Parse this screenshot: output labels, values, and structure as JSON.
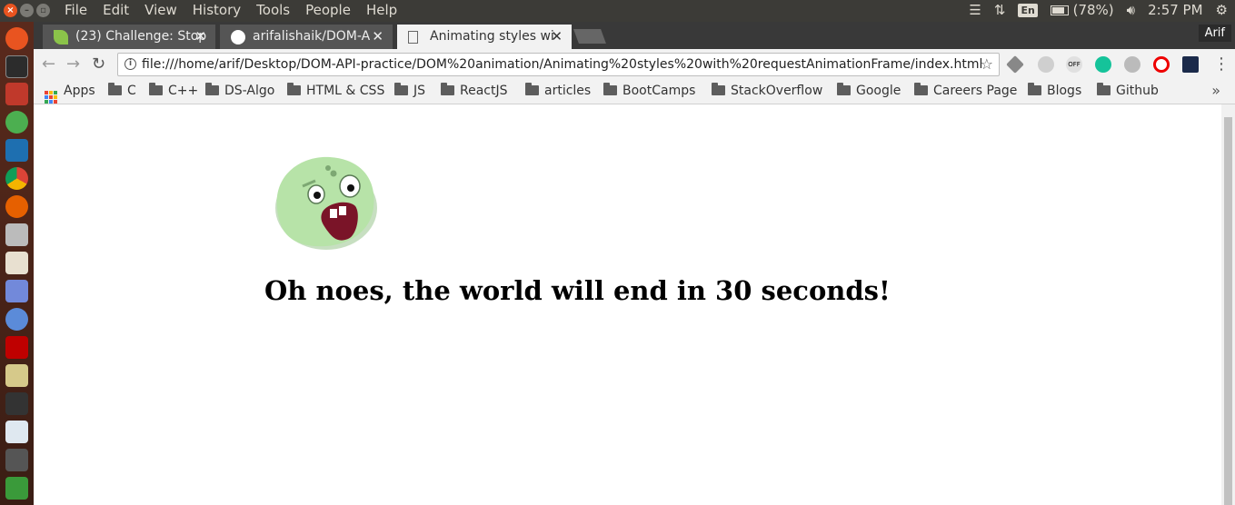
{
  "system": {
    "menu": [
      "File",
      "Edit",
      "View",
      "History",
      "Tools",
      "People",
      "Help"
    ],
    "keyboard": "En",
    "battery": "(78%)",
    "clock": "2:57 PM"
  },
  "browser": {
    "tabs": [
      {
        "label": "(23) Challenge: Stop"
      },
      {
        "label": "arifalishaik/DOM-A"
      },
      {
        "label": "Animating styles wi"
      }
    ],
    "user": "Arif",
    "url": "file:///home/arif/Desktop/DOM-API-practice/DOM%20animation/Animating%20styles%20with%20requestAnimationFrame/index.html",
    "bookmarks": [
      "Apps",
      "C",
      "C++",
      "DS-Algo",
      "HTML & CSS",
      "JS",
      "ReactJS",
      "articles",
      "BootCamps",
      "StackOverflow",
      "Google",
      "Careers Page",
      "Blogs",
      "Github"
    ]
  },
  "page": {
    "headline": "Oh noes, the world will end in 30 seconds!"
  },
  "colors": {
    "panel": "#3c3b37",
    "accent_close": "#e95420",
    "monster_green": "#b7e3a8",
    "mouth": "#7a1428"
  }
}
